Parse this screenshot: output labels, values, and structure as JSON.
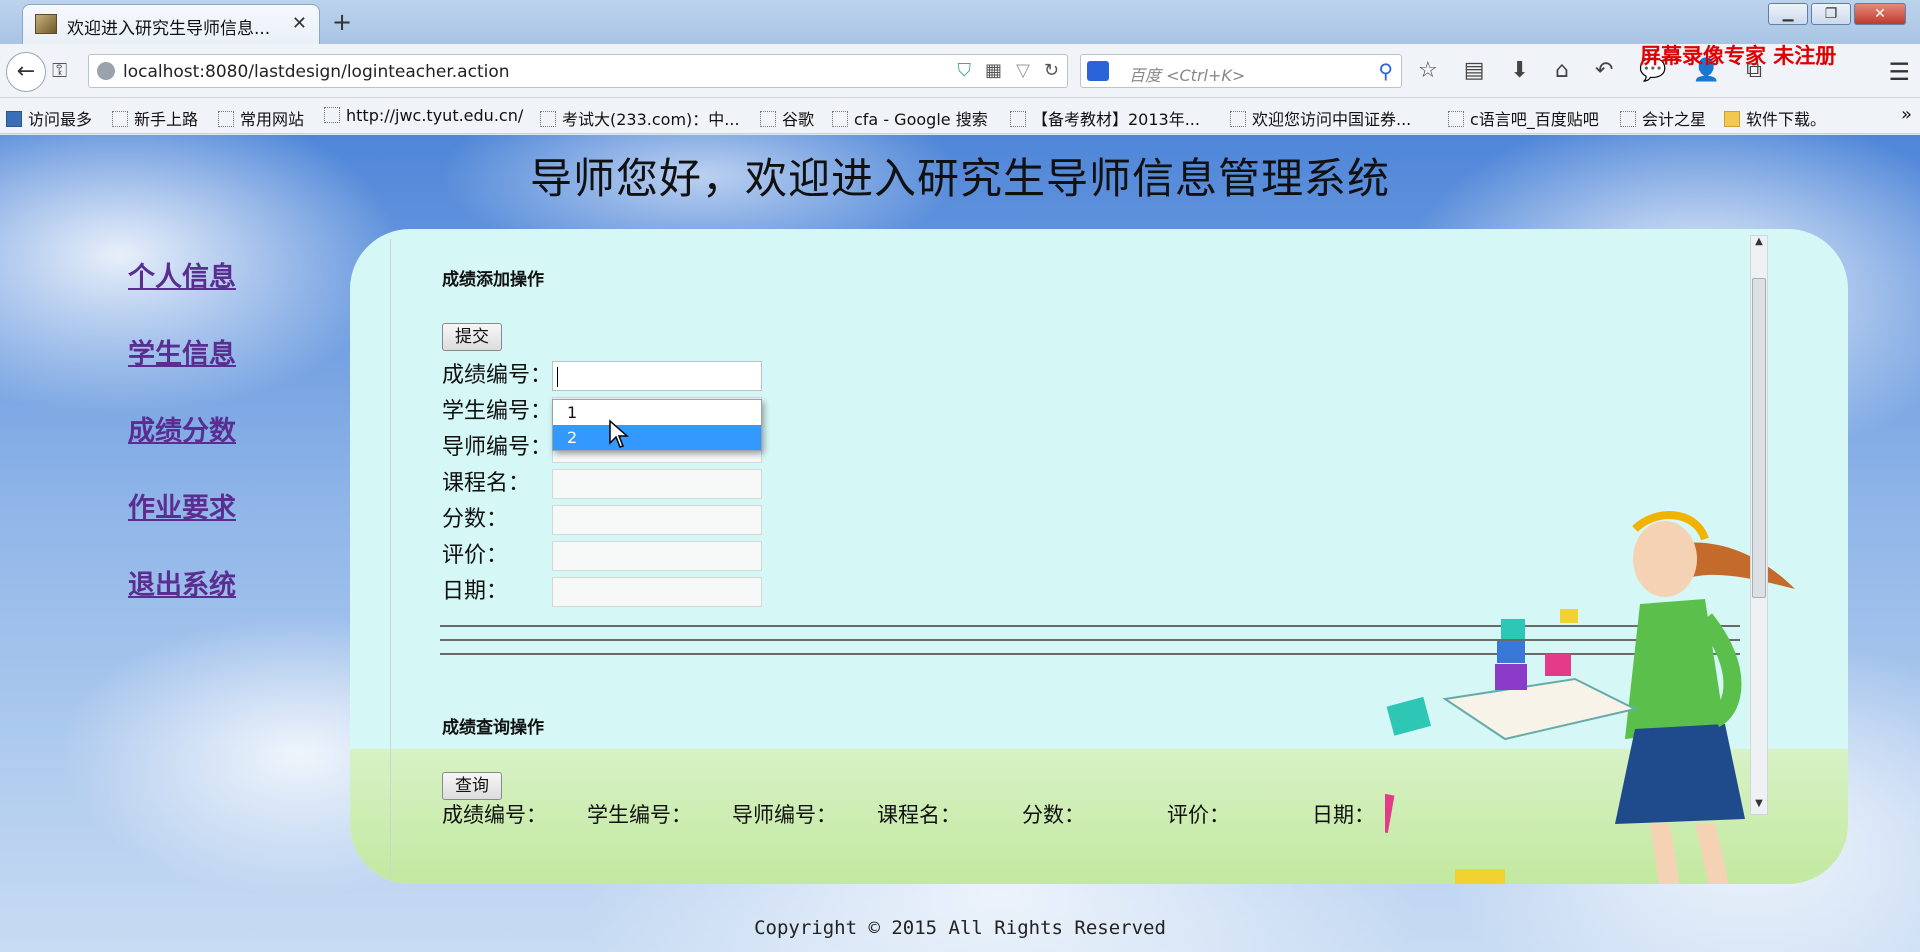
{
  "browser": {
    "tab_title": "欢迎进入研究生导师信息...",
    "url": "localhost:8080/lastdesign/loginteacher.action",
    "search_placeholder": "百度 <Ctrl+K>",
    "watermark": "屏幕录像专家 未注册",
    "bookmarks": [
      "访问最多",
      "新手上路",
      "常用网站",
      "http://jwc.tyut.edu.cn/",
      "考试大(233.com)：中...",
      "谷歌",
      "cfa - Google 搜索",
      "【备考教材】2013年...",
      "欢迎您访问中国证券...",
      "c语言吧_百度贴吧",
      "会计之星",
      "软件下载。"
    ]
  },
  "page": {
    "title": "导师您好，欢迎进入研究生导师信息管理系统",
    "nav": [
      "个人信息",
      "学生信息",
      "成绩分数",
      "作业要求",
      "退出系统"
    ],
    "add_section": {
      "title": "成绩添加操作",
      "submit_label": "提交",
      "fields": [
        {
          "label": "成绩编号：",
          "value": ""
        },
        {
          "label": "学生编号：",
          "value": ""
        },
        {
          "label": "导师编号：",
          "value": ""
        },
        {
          "label": "课程名：",
          "value": ""
        },
        {
          "label": "分数：",
          "value": ""
        },
        {
          "label": "评价：",
          "value": ""
        },
        {
          "label": "日期：",
          "value": ""
        }
      ],
      "autocomplete_options": [
        "1",
        "2"
      ],
      "autocomplete_selected": "2"
    },
    "query_section": {
      "title": "成绩查询操作",
      "query_label": "查询",
      "columns": [
        "成绩编号：",
        "学生编号：",
        "导师编号：",
        "课程名：",
        "分数：",
        "评价：",
        "日期："
      ]
    },
    "footer": "Copyright © 2015 All Rights Reserved"
  },
  "colors": {
    "link": "#5a2d91",
    "panel": "#d5f7f6",
    "selection": "#3399ff",
    "watermark": "#e00000"
  }
}
